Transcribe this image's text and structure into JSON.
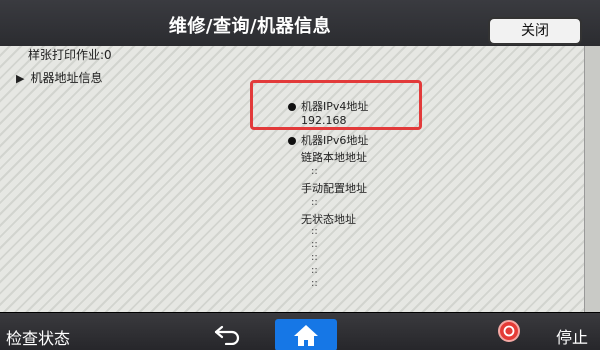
{
  "header": {
    "title": "维修/查询/机器信息",
    "close_label": "关闭"
  },
  "content": {
    "prev_item": "样张打印作业:0",
    "section": "机器地址信息",
    "ipv4": {
      "label": "机器IPv4地址",
      "value": "192.168"
    },
    "ipv6": {
      "label": "机器IPv6地址",
      "link_local_label": "链路本地地址",
      "manual_label": "手动配置地址",
      "stateless_label": "无状态地址",
      "separator": "::"
    }
  },
  "footer": {
    "status_label": "检查状态",
    "stop_label": "停止"
  },
  "colors": {
    "highlight": "#e23a3a",
    "home_button": "#1677e6",
    "stop_button": "#e43b36"
  },
  "icons": [
    "back-icon",
    "home-icon",
    "stop-icon",
    "triangle-right-icon"
  ]
}
